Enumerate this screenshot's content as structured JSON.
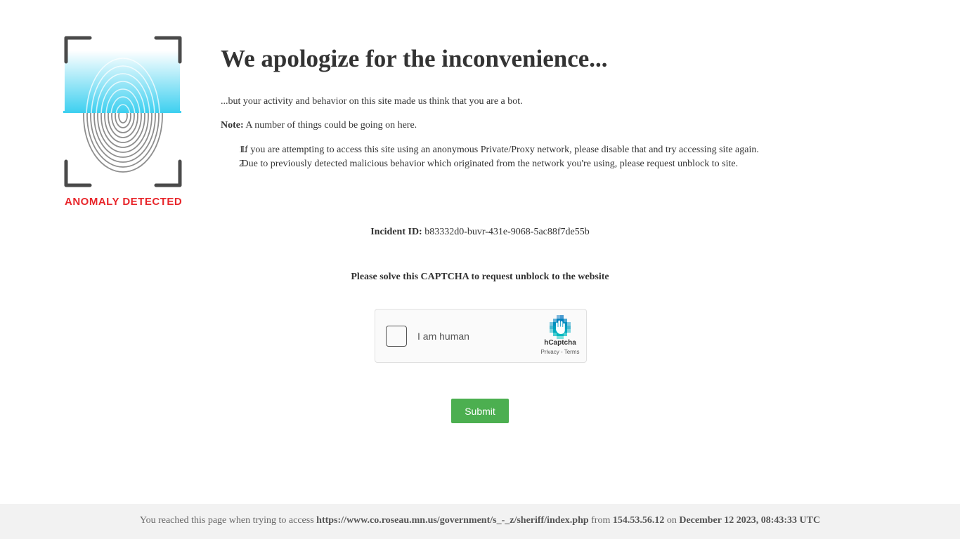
{
  "logo": {
    "text": "ANOMALY DETECTED",
    "icon": "fingerprint-scan-icon",
    "text_color": "#e8262b",
    "frame_color": "#4a4a4a",
    "scan_color": "#3fd0f0"
  },
  "main": {
    "title": "We apologize for the inconvenience...",
    "intro": "...but your activity and behavior on this site made us think that you are a bot.",
    "note_label": "Note:",
    "note_text": "A number of things could be going on here.",
    "reasons": [
      "If you are attempting to access this site using an anonymous Private/Proxy network, please disable that and try accessing site again.",
      "Due to previously detected malicious behavior which originated from the network you're using, please request unblock to site."
    ]
  },
  "incident": {
    "label": "Incident ID:",
    "value": "b83332d0-buvr-431e-9068-5ac88f7de55b"
  },
  "captcha": {
    "prompt": "Please solve this CAPTCHA to request unblock to the website",
    "checkbox_label": "I am human",
    "brand": "hCaptcha",
    "privacy_link": "Privacy",
    "link_separator": " - ",
    "terms_link": "Terms",
    "icon": "hcaptcha-hand-icon"
  },
  "submit": {
    "label": "Submit",
    "color": "#4caf50"
  },
  "footer": {
    "prefix": "You reached this page when trying to access",
    "url": "https://www.co.roseau.mn.us/government/s_-_z/sheriff/index.php",
    "from_word": "from",
    "ip": "154.53.56.12",
    "on_word": "on",
    "datetime": "December 12 2023, 08:43:33 UTC"
  }
}
